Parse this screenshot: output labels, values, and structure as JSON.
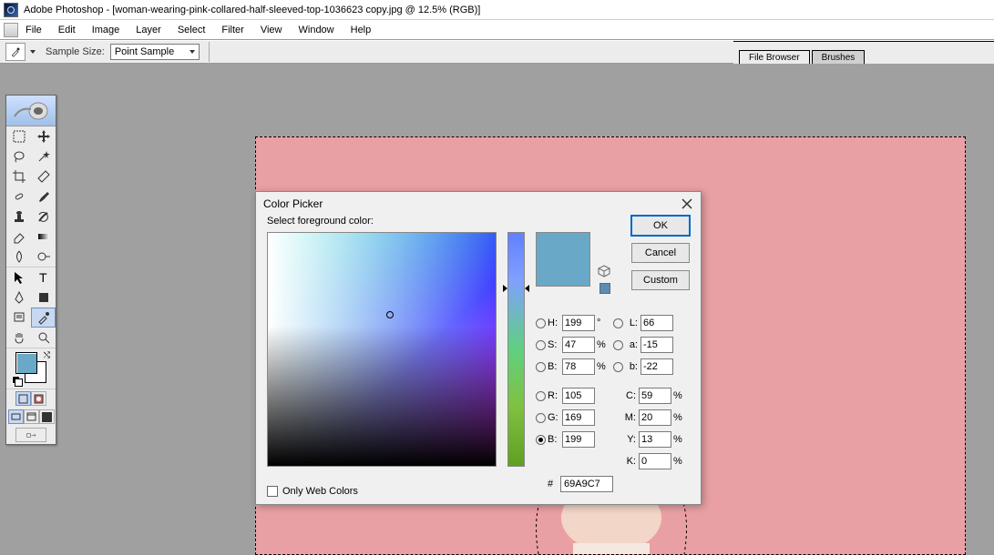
{
  "title": "Adobe Photoshop - [woman-wearing-pink-collared-half-sleeved-top-1036623 copy.jpg @ 12.5% (RGB)]",
  "menu": [
    "File",
    "Edit",
    "Image",
    "Layer",
    "Select",
    "Filter",
    "View",
    "Window",
    "Help"
  ],
  "options": {
    "sample_label": "Sample Size:",
    "sample_value": "Point Sample"
  },
  "palette_tabs": {
    "file_browser": "File Browser",
    "brushes": "Brushes"
  },
  "colors": {
    "foreground": "#69A9C7",
    "background": "#ffffff",
    "canvas_bg": "#e9a0a4"
  },
  "dialog": {
    "title": "Color Picker",
    "label": "Select foreground color:",
    "buttons": {
      "ok": "OK",
      "cancel": "Cancel",
      "custom": "Custom"
    },
    "owc": "Only Web Colors",
    "hsb": {
      "H": "199",
      "S": "47",
      "B": "78"
    },
    "lab": {
      "L": "66",
      "a": "-15",
      "b": "-22"
    },
    "rgb": {
      "R": "105",
      "G": "169",
      "B": "199"
    },
    "cmyk": {
      "C": "59",
      "M": "20",
      "Y": "13",
      "K": "0"
    },
    "hex": "69A9C7",
    "deg": "°",
    "pct": "%",
    "hash": "#",
    "labels": {
      "H": "H:",
      "S": "S:",
      "B": "B:",
      "L": "L:",
      "a": "a:",
      "b": "b:",
      "R": "R:",
      "G": "G:",
      "Bb": "B:",
      "C": "C:",
      "M": "M:",
      "Y": "Y:",
      "K": "K:"
    }
  }
}
